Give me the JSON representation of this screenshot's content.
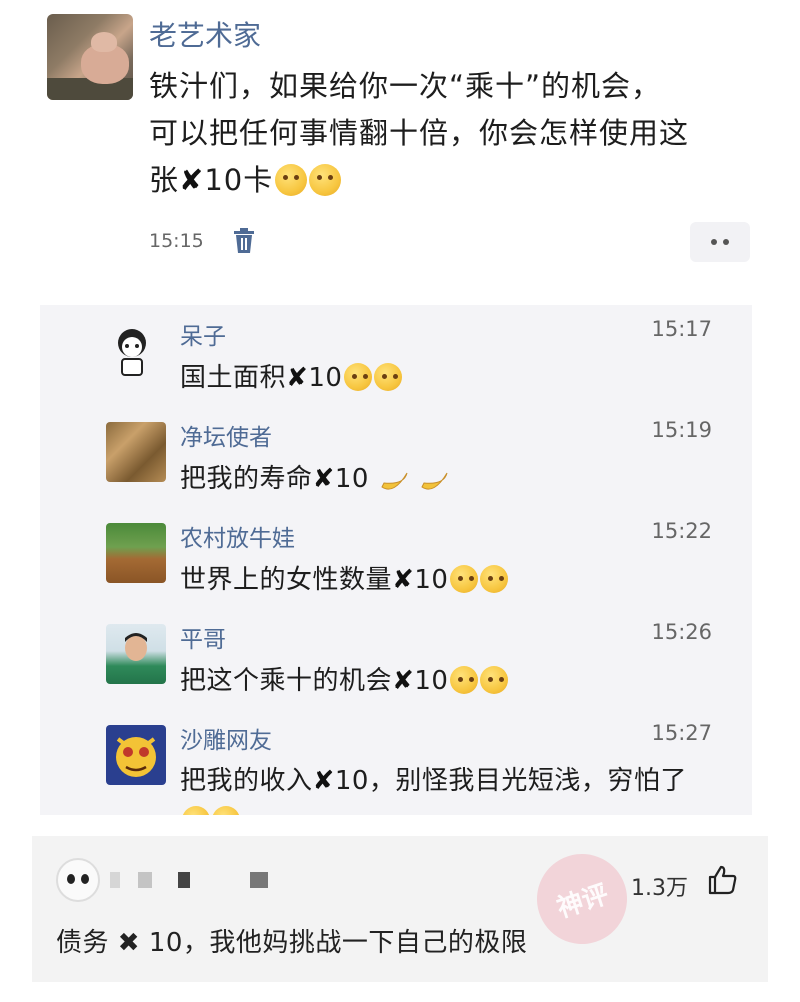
{
  "post": {
    "author": "老艺术家",
    "text_line1": "铁汁们，如果给你一次“乘十”的机会，",
    "text_line2": "可以把任何事情翻十倍，你会怎样使用这",
    "text_line3_prefix": "张",
    "text_line3_x": "✘",
    "text_line3_suffix": "10卡",
    "time": "15:15"
  },
  "comments": [
    {
      "name": "呆子",
      "time": "15:17",
      "prefix": "国土面积",
      "x": "✘",
      "suffix": "10",
      "emoji": "thinking"
    },
    {
      "name": "净坛使者",
      "time": "15:19",
      "prefix": "把我的寿命",
      "x": "✘",
      "suffix": "10",
      "emoji": "banana"
    },
    {
      "name": "农村放牛娃",
      "time": "15:22",
      "prefix": "世界上的女性数量",
      "x": "✘",
      "suffix": "10",
      "emoji": "grin"
    },
    {
      "name": "平哥",
      "time": "15:26",
      "prefix": "把这个乘十的机会",
      "x": "✘",
      "suffix": "10",
      "emoji": "smile"
    },
    {
      "name": "沙雕网友",
      "time": "15:27",
      "prefix": "把我的收入",
      "x": "✘",
      "suffix": "10，别怪我目光短浅，穷怕了",
      "emoji": "grin"
    }
  ],
  "bottom": {
    "likes": "1.3万",
    "text_x": "✖",
    "text": "债务 ✖ 10，我他妈挑战一下自己的极限",
    "watermark": "神评"
  },
  "colors": {
    "name_blue": "#4f6b95",
    "panel_bg": "#f4f4f7"
  }
}
